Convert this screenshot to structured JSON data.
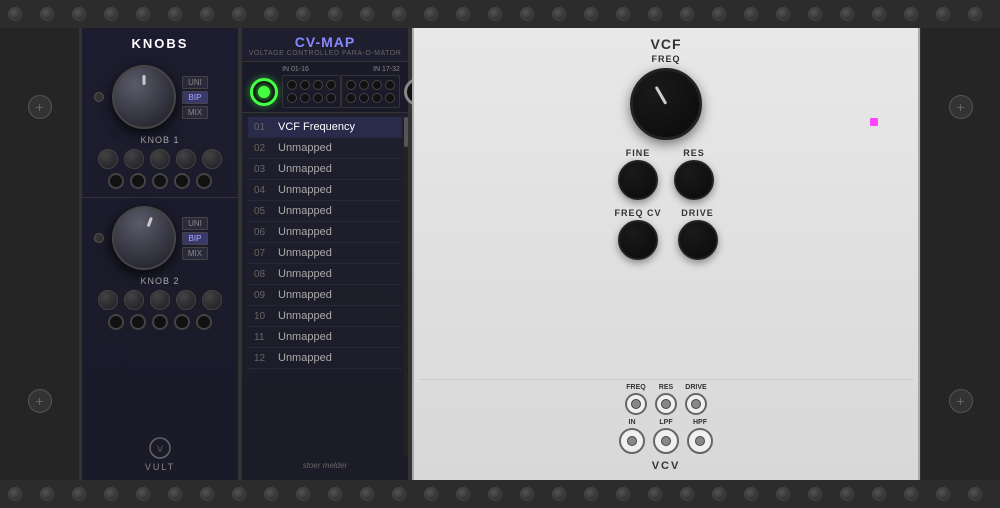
{
  "rack": {
    "background_color": "#1a1a1a"
  },
  "modules": {
    "knobs": {
      "title": "KNOBS",
      "knob1_label": "KNOB 1",
      "knob2_label": "KNOB 2",
      "mode_uni": "UNI",
      "mode_bip": "BIP",
      "mode_mix": "MIX",
      "brand": "VULT"
    },
    "cvmap": {
      "title": "CV-MAP",
      "subtitle": "VOLTAGE CONTROLLED PARA-O-MATOR",
      "port_in1_label": "IN 01-16",
      "port_in2_label": "IN 17-32",
      "list_items": [
        {
          "num": "01",
          "label": "VCF Frequency",
          "active": true
        },
        {
          "num": "02",
          "label": "Unmapped"
        },
        {
          "num": "03",
          "label": "Unmapped"
        },
        {
          "num": "04",
          "label": "Unmapped"
        },
        {
          "num": "05",
          "label": "Unmapped"
        },
        {
          "num": "06",
          "label": "Unmapped"
        },
        {
          "num": "07",
          "label": "Unmapped"
        },
        {
          "num": "08",
          "label": "Unmapped"
        },
        {
          "num": "09",
          "label": "Unmapped"
        },
        {
          "num": "10",
          "label": "Unmapped"
        },
        {
          "num": "11",
          "label": "Unmapped"
        },
        {
          "num": "12",
          "label": "Unmapped"
        }
      ],
      "brand_line1": "stoer",
      "brand_line2": "melder"
    },
    "vcf": {
      "title": "VCF",
      "freq_label": "FREQ",
      "fine_label": "FINE",
      "res_label": "RES",
      "freq_cv_label": "FREQ CV",
      "drive_label": "DRIVE",
      "port_freq_label": "FREQ",
      "port_res_label": "RES",
      "port_drive_label": "DRIVE",
      "port_in_label": "IN",
      "port_lpf_label": "LPF",
      "port_hpf_label": "HPF",
      "bottom_label": "VCV"
    }
  }
}
